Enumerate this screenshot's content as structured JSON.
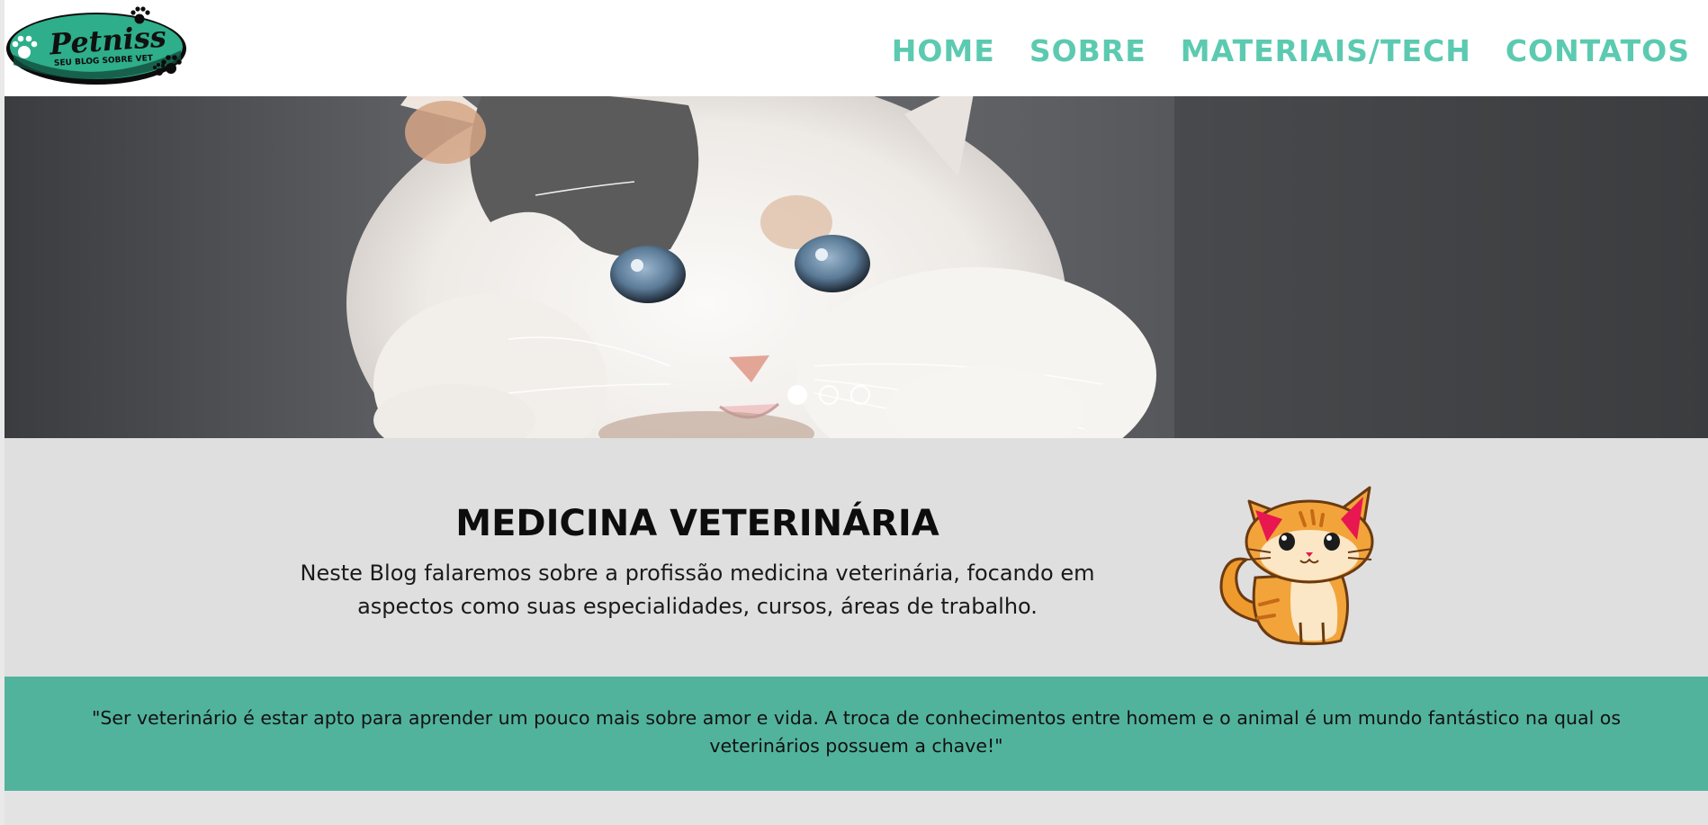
{
  "brand": {
    "name": "Petniss",
    "tagline": "SEU BLOG SOBRE VET",
    "logo_icon": "paw-print-icon",
    "colors": {
      "accent": "#5ccab0",
      "quote_bg": "#52b39d",
      "logo_green": "#2eae8a",
      "section_bg": "#dfdfdf"
    }
  },
  "nav": {
    "items": [
      {
        "label": "HOME"
      },
      {
        "label": "SOBRE"
      },
      {
        "label": "MATERIAIS/TECH"
      },
      {
        "label": "CONTATOS"
      }
    ]
  },
  "hero": {
    "image": "kitten-photo",
    "slides_total": 3,
    "active_slide": 1
  },
  "intro": {
    "title": "MEDICINA VETERINÁRIA",
    "text": "Neste Blog falaremos sobre a profissão medicina veterinária, focando em aspectos como suas especialidades, cursos, áreas de trabalho.",
    "illustration": "cartoon-cat-icon"
  },
  "quote": {
    "text": "\"Ser veterinário é estar apto para aprender um pouco mais sobre amor e vida. A troca de conhecimentos entre homem e o animal é um mundo fantástico na qual os veterinários possuem a chave!\""
  }
}
